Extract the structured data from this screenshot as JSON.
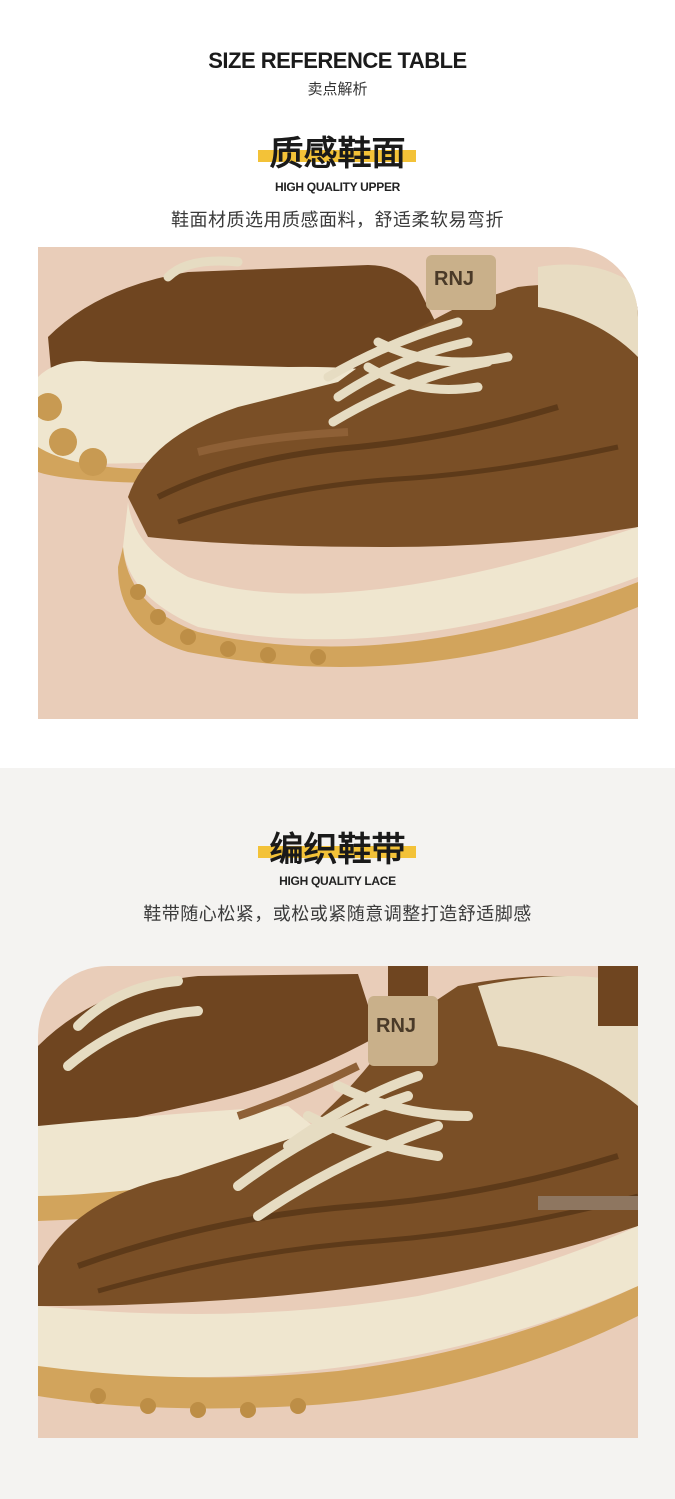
{
  "header": {
    "title": "SIZE REFERENCE TABLE",
    "subtitle": "卖点解析"
  },
  "features": [
    {
      "heading": "质感鞋面",
      "english": "HIGH QUALITY UPPER",
      "description": "鞋面材质选用质感面料，舒适柔软易弯折",
      "tag_text": "RNJ"
    },
    {
      "heading": "编织鞋带",
      "english": "HIGH QUALITY LACE",
      "description": "鞋带随心松紧，或松或紧随意调整打造舒适脚感",
      "tag_text": "RNJ"
    }
  ],
  "colors": {
    "highlight": "#f3c238",
    "leather": "#7a4f26",
    "sole": "#eee6cf",
    "outsole": "#d2a45c",
    "background": "#e9cdb9"
  }
}
